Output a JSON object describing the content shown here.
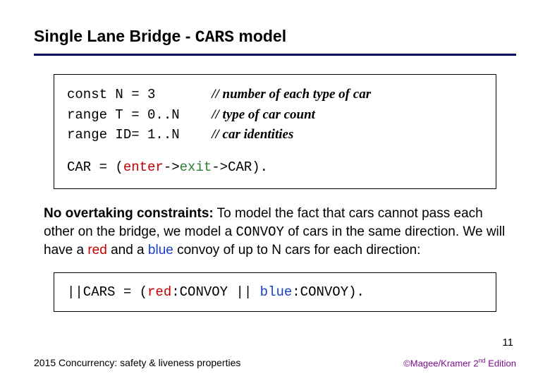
{
  "title": {
    "pre": "Single Lane Bridge - ",
    "mono": "CARS",
    "post": " model"
  },
  "box1": {
    "l1_code": "const N = 3       ",
    "l1_comment": "// number of each type of car",
    "l2_code": "range T = 0..N    ",
    "l2_comment": "// type of car count",
    "l3_code": "range ID= 1..N    ",
    "l3_comment": "// car identities",
    "l4_a": "CAR = (",
    "l4_enter": "enter",
    "l4_mid": "->",
    "l4_exit": "exit",
    "l4_b": "->CAR)."
  },
  "para": {
    "lead": "No overtaking constraints:",
    "t1": " To model the fact that cars cannot pass each other on the bridge, we model a ",
    "convoy": "CONVOY",
    "t2": " of cars in the same direction.  We will have a ",
    "red": "red",
    "t3": " and a ",
    "blue": "blue",
    "t4": " convoy of up to N cars for each direction:"
  },
  "box2": {
    "a": "||CARS = (",
    "red": "red",
    "b": ":CONVOY || ",
    "blue": "blue",
    "c": ":CONVOY)."
  },
  "pagenum": "11",
  "footer_left": "2015  Concurrency: safety & liveness properties",
  "footer_right": {
    "a": "©Magee/Kramer 2",
    "sup": "nd",
    "b": " Edition"
  }
}
